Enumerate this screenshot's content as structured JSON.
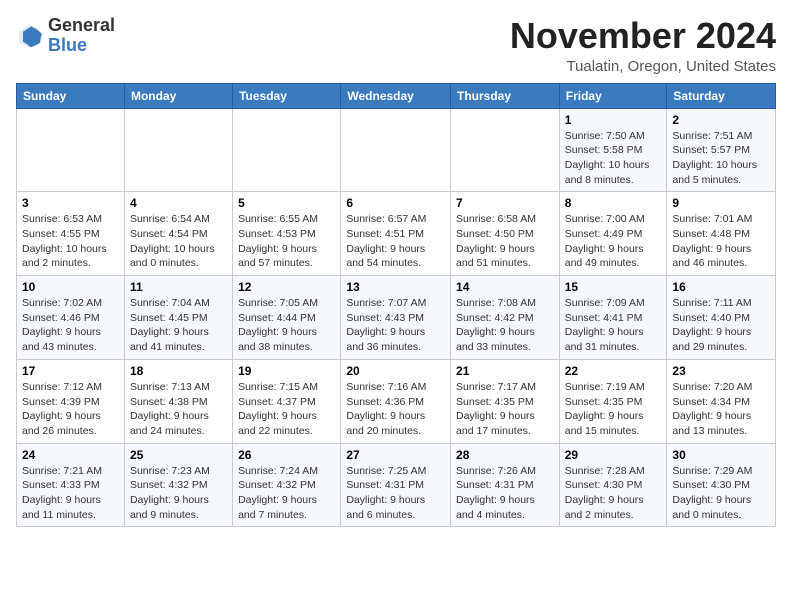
{
  "app": {
    "name_general": "General",
    "name_blue": "Blue"
  },
  "title": "November 2024",
  "location": "Tualatin, Oregon, United States",
  "weekdays": [
    "Sunday",
    "Monday",
    "Tuesday",
    "Wednesday",
    "Thursday",
    "Friday",
    "Saturday"
  ],
  "weeks": [
    [
      {
        "day": "",
        "info": ""
      },
      {
        "day": "",
        "info": ""
      },
      {
        "day": "",
        "info": ""
      },
      {
        "day": "",
        "info": ""
      },
      {
        "day": "",
        "info": ""
      },
      {
        "day": "1",
        "info": "Sunrise: 7:50 AM\nSunset: 5:58 PM\nDaylight: 10 hours\nand 8 minutes."
      },
      {
        "day": "2",
        "info": "Sunrise: 7:51 AM\nSunset: 5:57 PM\nDaylight: 10 hours\nand 5 minutes."
      }
    ],
    [
      {
        "day": "3",
        "info": "Sunrise: 6:53 AM\nSunset: 4:55 PM\nDaylight: 10 hours\nand 2 minutes."
      },
      {
        "day": "4",
        "info": "Sunrise: 6:54 AM\nSunset: 4:54 PM\nDaylight: 10 hours\nand 0 minutes."
      },
      {
        "day": "5",
        "info": "Sunrise: 6:55 AM\nSunset: 4:53 PM\nDaylight: 9 hours\nand 57 minutes."
      },
      {
        "day": "6",
        "info": "Sunrise: 6:57 AM\nSunset: 4:51 PM\nDaylight: 9 hours\nand 54 minutes."
      },
      {
        "day": "7",
        "info": "Sunrise: 6:58 AM\nSunset: 4:50 PM\nDaylight: 9 hours\nand 51 minutes."
      },
      {
        "day": "8",
        "info": "Sunrise: 7:00 AM\nSunset: 4:49 PM\nDaylight: 9 hours\nand 49 minutes."
      },
      {
        "day": "9",
        "info": "Sunrise: 7:01 AM\nSunset: 4:48 PM\nDaylight: 9 hours\nand 46 minutes."
      }
    ],
    [
      {
        "day": "10",
        "info": "Sunrise: 7:02 AM\nSunset: 4:46 PM\nDaylight: 9 hours\nand 43 minutes."
      },
      {
        "day": "11",
        "info": "Sunrise: 7:04 AM\nSunset: 4:45 PM\nDaylight: 9 hours\nand 41 minutes."
      },
      {
        "day": "12",
        "info": "Sunrise: 7:05 AM\nSunset: 4:44 PM\nDaylight: 9 hours\nand 38 minutes."
      },
      {
        "day": "13",
        "info": "Sunrise: 7:07 AM\nSunset: 4:43 PM\nDaylight: 9 hours\nand 36 minutes."
      },
      {
        "day": "14",
        "info": "Sunrise: 7:08 AM\nSunset: 4:42 PM\nDaylight: 9 hours\nand 33 minutes."
      },
      {
        "day": "15",
        "info": "Sunrise: 7:09 AM\nSunset: 4:41 PM\nDaylight: 9 hours\nand 31 minutes."
      },
      {
        "day": "16",
        "info": "Sunrise: 7:11 AM\nSunset: 4:40 PM\nDaylight: 9 hours\nand 29 minutes."
      }
    ],
    [
      {
        "day": "17",
        "info": "Sunrise: 7:12 AM\nSunset: 4:39 PM\nDaylight: 9 hours\nand 26 minutes."
      },
      {
        "day": "18",
        "info": "Sunrise: 7:13 AM\nSunset: 4:38 PM\nDaylight: 9 hours\nand 24 minutes."
      },
      {
        "day": "19",
        "info": "Sunrise: 7:15 AM\nSunset: 4:37 PM\nDaylight: 9 hours\nand 22 minutes."
      },
      {
        "day": "20",
        "info": "Sunrise: 7:16 AM\nSunset: 4:36 PM\nDaylight: 9 hours\nand 20 minutes."
      },
      {
        "day": "21",
        "info": "Sunrise: 7:17 AM\nSunset: 4:35 PM\nDaylight: 9 hours\nand 17 minutes."
      },
      {
        "day": "22",
        "info": "Sunrise: 7:19 AM\nSunset: 4:35 PM\nDaylight: 9 hours\nand 15 minutes."
      },
      {
        "day": "23",
        "info": "Sunrise: 7:20 AM\nSunset: 4:34 PM\nDaylight: 9 hours\nand 13 minutes."
      }
    ],
    [
      {
        "day": "24",
        "info": "Sunrise: 7:21 AM\nSunset: 4:33 PM\nDaylight: 9 hours\nand 11 minutes."
      },
      {
        "day": "25",
        "info": "Sunrise: 7:23 AM\nSunset: 4:32 PM\nDaylight: 9 hours\nand 9 minutes."
      },
      {
        "day": "26",
        "info": "Sunrise: 7:24 AM\nSunset: 4:32 PM\nDaylight: 9 hours\nand 7 minutes."
      },
      {
        "day": "27",
        "info": "Sunrise: 7:25 AM\nSunset: 4:31 PM\nDaylight: 9 hours\nand 6 minutes."
      },
      {
        "day": "28",
        "info": "Sunrise: 7:26 AM\nSunset: 4:31 PM\nDaylight: 9 hours\nand 4 minutes."
      },
      {
        "day": "29",
        "info": "Sunrise: 7:28 AM\nSunset: 4:30 PM\nDaylight: 9 hours\nand 2 minutes."
      },
      {
        "day": "30",
        "info": "Sunrise: 7:29 AM\nSunset: 4:30 PM\nDaylight: 9 hours\nand 0 minutes."
      }
    ]
  ]
}
